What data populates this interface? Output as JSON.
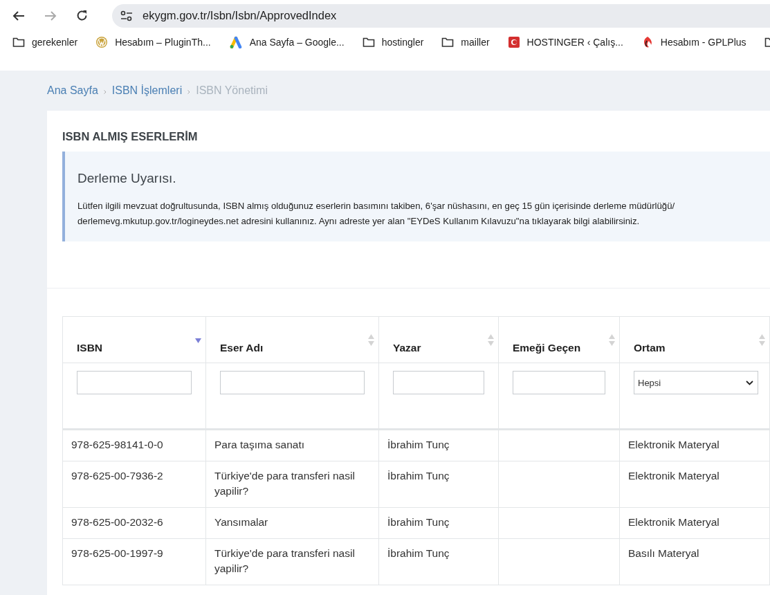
{
  "browser": {
    "url": "ekygm.gov.tr/Isbn/Isbn/ApprovedIndex",
    "forward_disabled": true
  },
  "bookmarks": [
    {
      "kind": "folder",
      "label": "gerekenler"
    },
    {
      "kind": "wordpress",
      "label": "Hesabım – PluginTh..."
    },
    {
      "kind": "ads",
      "label": "Ana Sayfa – Google..."
    },
    {
      "kind": "folder",
      "label": "hostingler"
    },
    {
      "kind": "folder",
      "label": "mailler"
    },
    {
      "kind": "hostinger",
      "label": "HOSTINGER ‹ Çalış..."
    },
    {
      "kind": "gpl",
      "label": "Hesabım - GPLPlus"
    },
    {
      "kind": "folder"
    }
  ],
  "breadcrumb": [
    {
      "label": "Ana Sayfa",
      "current": false
    },
    {
      "label": "ISBN İşlemleri",
      "current": false
    },
    {
      "label": "ISBN Yönetimi",
      "current": true
    }
  ],
  "page_title": "ISBN ALMIŞ ESERLERİM",
  "alert": {
    "title": "Derleme Uyarısı.",
    "text": "Lütfen ilgili mevzuat doğrultusunda, ISBN almış olduğunuz eserlerin basımını takiben, 6'şar nüshasını, en geç 15 gün içerisinde derleme müdürlüğü/ derlemevg.mkutup.gov.tr/logineydes.net adresini kullanınız. Aynı adreste yer alan \"EYDeS Kullanım Kılavuzu\"na tıklayarak bilgi alabilirsiniz."
  },
  "table": {
    "columns": [
      {
        "label": "ISBN",
        "sorted": true,
        "filter": {
          "kind": "text"
        }
      },
      {
        "label": "Eser Adı",
        "sorted": false,
        "filter": {
          "kind": "text"
        }
      },
      {
        "label": "Yazar",
        "sorted": false,
        "filter": {
          "kind": "text"
        }
      },
      {
        "label": "Emeği Geçen",
        "sorted": false,
        "filter": {
          "kind": "text"
        }
      },
      {
        "label": "Ortam",
        "sorted": false,
        "filter": {
          "kind": "select",
          "value": "Hepsi"
        }
      }
    ],
    "rows": [
      {
        "isbn": "978-625-98141-0-0",
        "eser_adi": "Para taşıma sanatı",
        "yazar": "İbrahim Tunç",
        "ortam": "Elektronik Materyal"
      },
      {
        "isbn": "978-625-00-7936-2",
        "eser_adi": "Türkiye'de para transferi nasil yapilir?",
        "yazar": "İbrahim Tunç",
        "ortam": "Elektronik Materyal"
      },
      {
        "isbn": "978-625-00-2032-6",
        "eser_adi": "Yansımalar",
        "yazar": "İbrahim Tunç",
        "ortam": "Elektronik Materyal"
      },
      {
        "isbn": "978-625-00-1997-9",
        "eser_adi": "Türkiye'de para transferi nasil yapilir?",
        "yazar": "İbrahim Tunç",
        "ortam": "Basılı Materyal"
      }
    ]
  }
}
